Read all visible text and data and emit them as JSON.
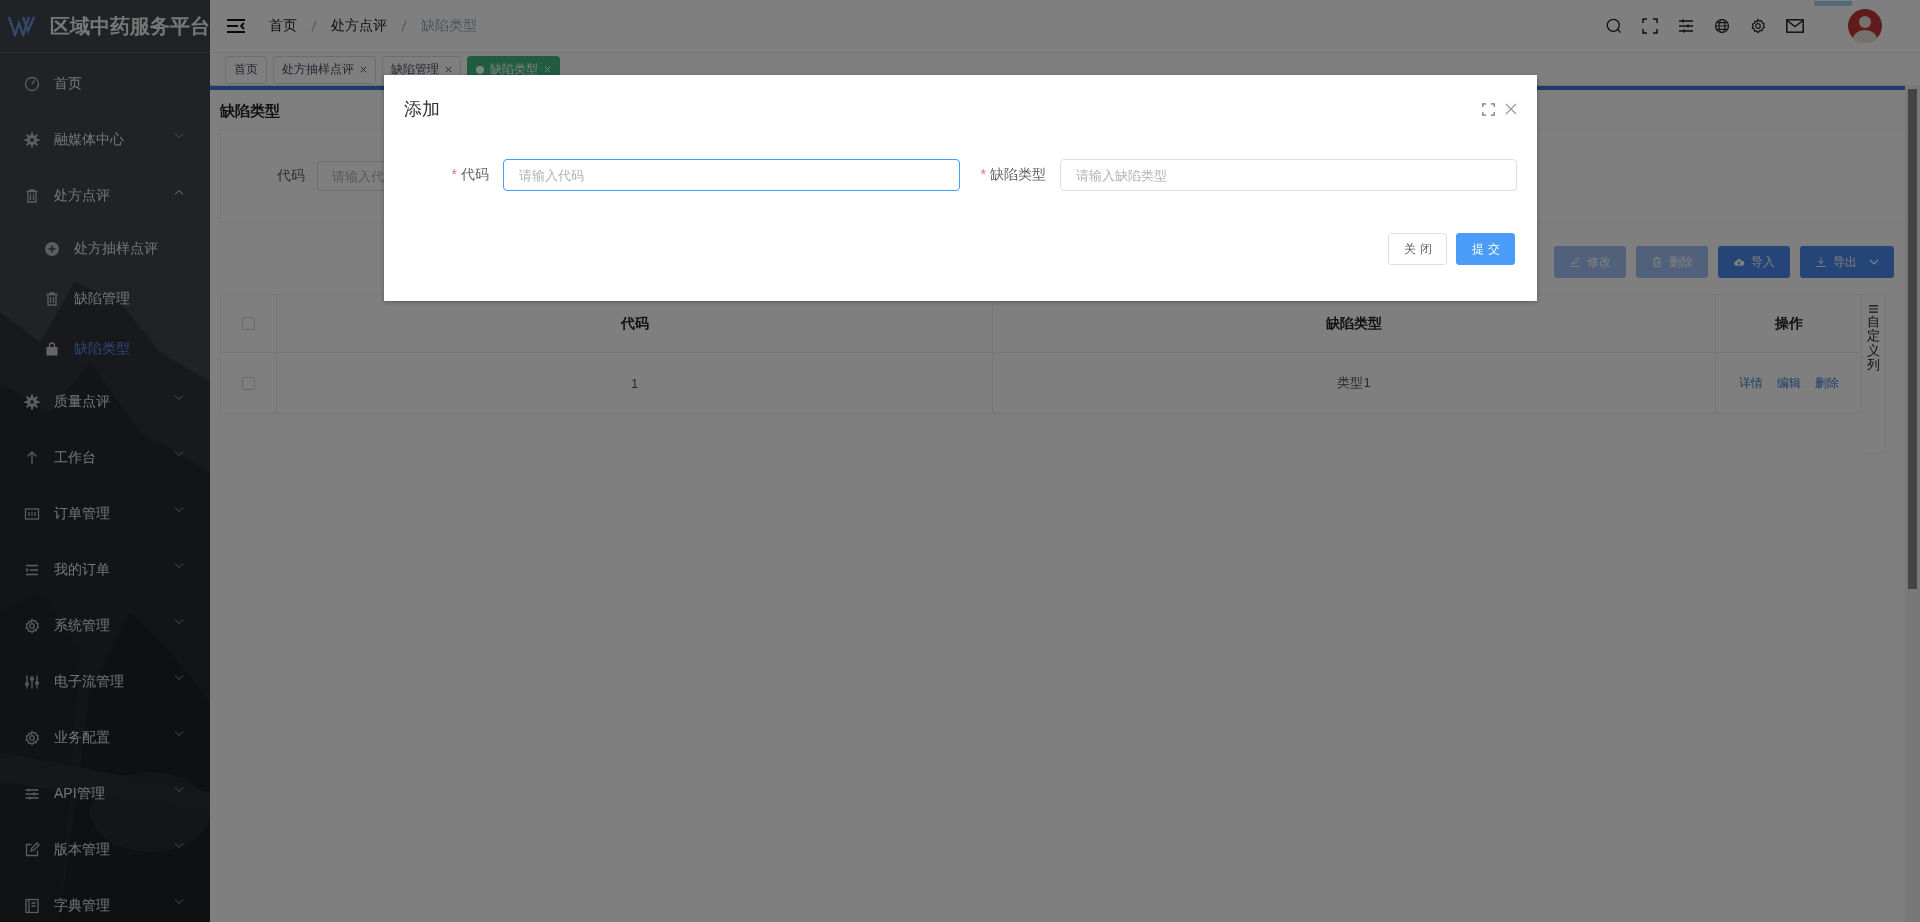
{
  "app": {
    "title": "区域中药服务平台"
  },
  "nav_items": [
    {
      "label": "首页",
      "kind": "link",
      "selected": false
    },
    {
      "label": "融媒体中心",
      "kind": "group",
      "expanded": false,
      "selected": false
    },
    {
      "label": "处方点评",
      "kind": "group",
      "expanded": true,
      "selected": false,
      "children": [
        {
          "label": "处方抽样点评",
          "selected": false
        },
        {
          "label": "缺陷管理",
          "selected": false
        },
        {
          "label": "缺陷类型",
          "selected": true
        }
      ]
    },
    {
      "label": "质量点评",
      "kind": "group",
      "expanded": false,
      "selected": false
    },
    {
      "label": "工作台",
      "kind": "group",
      "expanded": false,
      "selected": false
    },
    {
      "label": "订单管理",
      "kind": "group",
      "expanded": false,
      "selected": false
    },
    {
      "label": "我的订单",
      "kind": "group",
      "expanded": false,
      "selected": false
    },
    {
      "label": "系统管理",
      "kind": "group",
      "expanded": false,
      "selected": false
    },
    {
      "label": "电子流管理",
      "kind": "group",
      "expanded": false,
      "selected": false
    },
    {
      "label": "业务配置",
      "kind": "group",
      "expanded": false,
      "selected": false
    },
    {
      "label": "API管理",
      "kind": "group",
      "expanded": false,
      "selected": false
    },
    {
      "label": "版本管理",
      "kind": "group",
      "expanded": false,
      "selected": false
    },
    {
      "label": "字典管理",
      "kind": "group",
      "expanded": false,
      "selected": false
    }
  ],
  "breadcrumb": [
    "首页",
    "处方点评",
    "缺陷类型"
  ],
  "tabs": [
    {
      "label": "首页",
      "selected": false,
      "closable": false
    },
    {
      "label": "处方抽样点评",
      "selected": false,
      "closable": true
    },
    {
      "label": "缺陷管理",
      "selected": false,
      "closable": true
    },
    {
      "label": "缺陷类型",
      "selected": true,
      "closable": true
    }
  ],
  "page_title": "缺陷类型",
  "search_form": {
    "label": "代码",
    "placeholder": "请输入代"
  },
  "toolbar": [
    {
      "label": "修改",
      "kind": "edit",
      "disabled": true
    },
    {
      "label": "删除",
      "kind": "delete",
      "disabled": true
    },
    {
      "label": "导入",
      "kind": "import",
      "disabled": false
    },
    {
      "label": "导出",
      "kind": "export",
      "disabled": false
    }
  ],
  "table": {
    "header_checked": false,
    "columns": [
      "代码",
      "缺陷类型",
      "操作"
    ],
    "rows": [
      {
        "selected": false,
        "cells": [
          "1",
          "类型1"
        ],
        "actions": [
          "详情",
          "编辑",
          "删除"
        ]
      }
    ],
    "column_toggle": "自定义列"
  },
  "dialog": {
    "title": "添加",
    "fields": [
      {
        "label": "代码",
        "placeholder": "请输入代码",
        "required_mark": "*",
        "focused": true
      },
      {
        "label": "缺陷类型",
        "placeholder": "请输入缺陷类型",
        "required_mark": "*",
        "focused": false
      }
    ],
    "buttons": [
      {
        "label": "关闭",
        "kind": "default"
      },
      {
        "label": "提交",
        "kind": "primary"
      }
    ]
  }
}
